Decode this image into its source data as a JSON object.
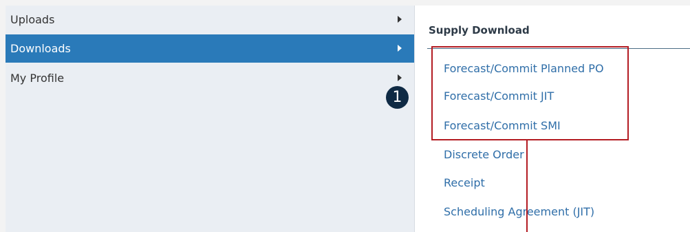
{
  "sidebar": {
    "items": [
      {
        "label": "Uploads"
      },
      {
        "label": "Downloads"
      },
      {
        "label": "My Profile"
      }
    ]
  },
  "annotation": {
    "step_number": "1"
  },
  "submenu": {
    "title": "Supply Download",
    "links": [
      {
        "label": "Forecast/Commit Planned PO"
      },
      {
        "label": "Forecast/Commit JIT"
      },
      {
        "label": "Forecast/Commit SMI"
      },
      {
        "label": "Discrete Order"
      },
      {
        "label": "Receipt"
      },
      {
        "label": "Scheduling Agreement (JIT)"
      }
    ]
  },
  "colors": {
    "active_item_bg": "#2a7ab9",
    "link": "#2f6ea8",
    "highlight": "#b31b22",
    "badge_bg": "#0f2a44"
  }
}
